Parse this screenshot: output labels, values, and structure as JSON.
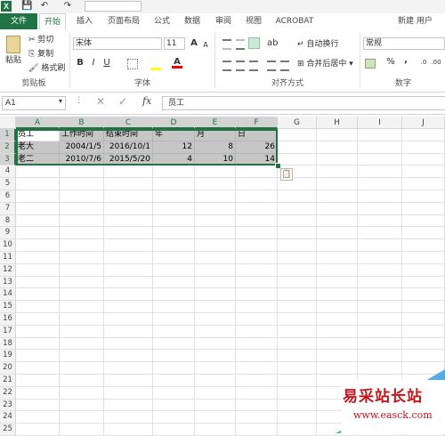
{
  "quick_access": {
    "logo": "X",
    "save": "💾",
    "undo": "↶",
    "redo": "↷"
  },
  "tabs": [
    "文件",
    "开始",
    "插入",
    "页面布局",
    "公式",
    "数据",
    "审阅",
    "视图",
    "ACROBAT"
  ],
  "user_link": "新建 用户",
  "ribbon": {
    "clipboard": {
      "paste": "粘贴",
      "cut": "剪切",
      "copy": "复制",
      "format_painter": "格式刷",
      "label": "剪贴板"
    },
    "font": {
      "name": "宋体",
      "size": "11",
      "grow": "A",
      "shrink": "A",
      "bold": "B",
      "italic": "I",
      "underline": "U",
      "font_color": "A",
      "label": "字体"
    },
    "alignment": {
      "wrap": "自动换行",
      "merge": "合并后居中",
      "label": "对齐方式"
    },
    "number": {
      "format": "常规",
      "percent": "%",
      "comma": ",",
      "label": "数字"
    }
  },
  "formula_bar": {
    "name_box": "A1",
    "fx": "fx",
    "value": "员工"
  },
  "columns": [
    "A",
    "B",
    "C",
    "D",
    "E",
    "F",
    "G",
    "H",
    "I",
    "J"
  ],
  "rows": [
    "1",
    "2",
    "3",
    "4",
    "5",
    "6",
    "7",
    "8",
    "9",
    "10",
    "11",
    "12",
    "13",
    "14",
    "15",
    "16",
    "17",
    "18",
    "19",
    "20",
    "21",
    "22",
    "23",
    "24",
    "25"
  ],
  "table": {
    "header": [
      "员工",
      "工作时间",
      "结束时间",
      "年",
      "月",
      "日"
    ],
    "data": [
      [
        "老大",
        "2004/1/5",
        "2016/10/1",
        "12",
        "8",
        "26"
      ],
      [
        "老二",
        "2010/7/6",
        "2015/5/20",
        "4",
        "10",
        "14"
      ]
    ]
  },
  "watermark": {
    "title": "易采站长站",
    "url": "www.easck.com"
  }
}
